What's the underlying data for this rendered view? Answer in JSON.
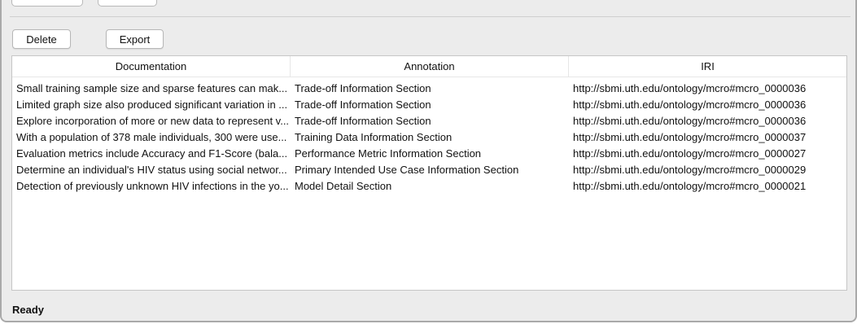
{
  "toolbar": {
    "delete_label": "Delete",
    "export_label": "Export"
  },
  "table": {
    "columns": [
      "Documentation",
      "Annotation",
      "IRI"
    ],
    "rows": [
      [
        "Small training sample size and sparse features can mak...",
        "Trade-off Information Section",
        "http://sbmi.uth.edu/ontology/mcro#mcro_0000036"
      ],
      [
        "Limited graph size also produced significant variation in ...",
        "Trade-off Information Section",
        "http://sbmi.uth.edu/ontology/mcro#mcro_0000036"
      ],
      [
        "Explore incorporation of more or new data to represent v...",
        "Trade-off Information Section",
        "http://sbmi.uth.edu/ontology/mcro#mcro_0000036"
      ],
      [
        "With a population of 378 male individuals, 300 were use...",
        "Training Data Information Section",
        "http://sbmi.uth.edu/ontology/mcro#mcro_0000037"
      ],
      [
        "Evaluation metrics include Accuracy and F1-Score (bala...",
        "Performance Metric Information Section",
        "http://sbmi.uth.edu/ontology/mcro#mcro_0000027"
      ],
      [
        "Determine an individual's HIV status using social networ...",
        "Primary Intended Use Case Information Section",
        "http://sbmi.uth.edu/ontology/mcro#mcro_0000029"
      ],
      [
        "Detection of previously unknown HIV infections in the yo...",
        "Model Detail Section",
        "http://sbmi.uth.edu/ontology/mcro#mcro_0000021"
      ]
    ]
  },
  "status": {
    "text": "Ready"
  }
}
